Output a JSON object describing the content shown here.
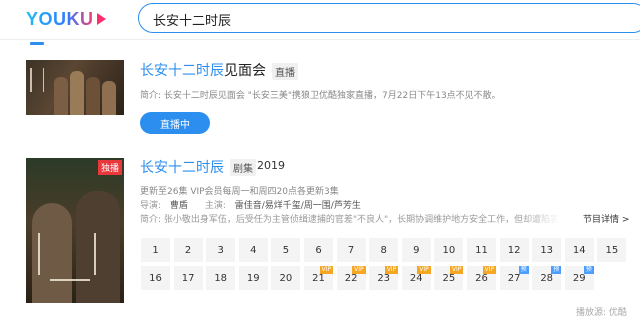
{
  "header": {
    "logo": "YOUKU",
    "search_value": "长安十二时辰"
  },
  "result1": {
    "title_highlight": "长安十二时辰",
    "title_rest": "见面会",
    "badge": "直播",
    "desc": "简介: 长安十二时辰见面会 \"长安三美\"携狼卫优酷独家直播，7月22日下午13点不见不散。",
    "button": "直播中"
  },
  "result2": {
    "title": "长安十二时辰",
    "badge": "剧集",
    "year": "2019",
    "poster_badge": "独播",
    "update": "更新至26集 VIP会员每周一和周四20点各更新3集",
    "director_label": "导演:",
    "director": "曹盾",
    "cast_label": "主演:",
    "cast": "雷佳音/易烊千玺/周一围/芦芳生",
    "desc": "简介: 张小敬出身军伍，后受任为主管侦缉逮捕的官差\"不良人\"，长期协调维护地方安全工作，但却遭陷害被关入死牢",
    "more": "节目详情 >",
    "episodes": [
      {
        "n": "1",
        "tag": ""
      },
      {
        "n": "2",
        "tag": ""
      },
      {
        "n": "3",
        "tag": ""
      },
      {
        "n": "4",
        "tag": ""
      },
      {
        "n": "5",
        "tag": ""
      },
      {
        "n": "6",
        "tag": ""
      },
      {
        "n": "7",
        "tag": ""
      },
      {
        "n": "8",
        "tag": ""
      },
      {
        "n": "9",
        "tag": ""
      },
      {
        "n": "10",
        "tag": ""
      },
      {
        "n": "11",
        "tag": ""
      },
      {
        "n": "12",
        "tag": ""
      },
      {
        "n": "13",
        "tag": ""
      },
      {
        "n": "14",
        "tag": ""
      },
      {
        "n": "15",
        "tag": ""
      },
      {
        "n": "16",
        "tag": ""
      },
      {
        "n": "17",
        "tag": ""
      },
      {
        "n": "18",
        "tag": ""
      },
      {
        "n": "19",
        "tag": ""
      },
      {
        "n": "20",
        "tag": ""
      },
      {
        "n": "21",
        "tag": "VIP"
      },
      {
        "n": "22",
        "tag": "VIP"
      },
      {
        "n": "23",
        "tag": "VIP"
      },
      {
        "n": "24",
        "tag": "VIP"
      },
      {
        "n": "25",
        "tag": "VIP"
      },
      {
        "n": "26",
        "tag": "VIP"
      },
      {
        "n": "27",
        "tag": "预"
      },
      {
        "n": "28",
        "tag": "预"
      },
      {
        "n": "29",
        "tag": "预"
      }
    ]
  },
  "footer": {
    "source": "播放源: 优酷"
  },
  "colors": {
    "accent": "#2c8ff0",
    "vip": "#f5a623",
    "preview": "#4b9dff",
    "exclusive": "#e9383b"
  }
}
